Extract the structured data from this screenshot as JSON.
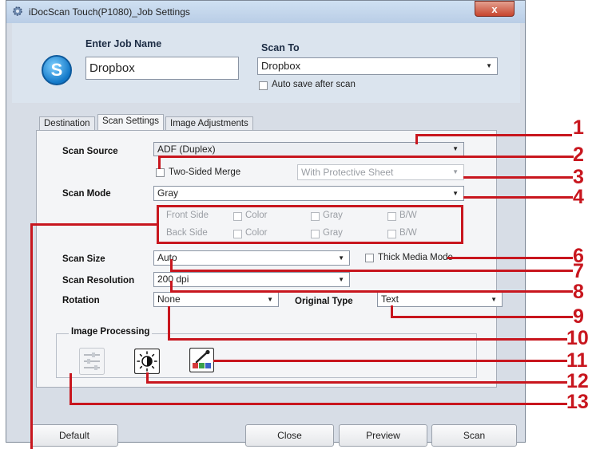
{
  "window": {
    "title": "iDocScan Touch(P1080)_Job Settings",
    "close_glyph": "x"
  },
  "header": {
    "job_name_label": "Enter Job Name",
    "job_name_value": "Dropbox",
    "scan_to_label": "Scan To",
    "scan_to_value": "Dropbox",
    "auto_save_label": "Auto save after scan",
    "logo_letter": "S"
  },
  "tabs": [
    {
      "label": "Destination"
    },
    {
      "label": "Scan Settings"
    },
    {
      "label": "Image Adjustments"
    }
  ],
  "settings": {
    "scan_source_label": "Scan Source",
    "scan_source_value": "ADF (Duplex)",
    "two_sided_merge_label": "Two-Sided Merge",
    "protective_sheet_value": "With Protective Sheet",
    "scan_mode_label": "Scan Mode",
    "scan_mode_value": "Gray",
    "front_side_label": "Front Side",
    "back_side_label": "Back Side",
    "color_label": "Color",
    "gray_label": "Gray",
    "bw_label": "B/W",
    "scan_size_label": "Scan Size",
    "scan_size_value": "Auto",
    "thick_media_label": "Thick Media Mode",
    "scan_resolution_label": "Scan Resolution",
    "scan_resolution_value": "200 dpi",
    "rotation_label": "Rotation",
    "rotation_value": "None",
    "original_type_label": "Original Type",
    "original_type_value": "Text",
    "image_processing_label": "Image Processing"
  },
  "buttons": {
    "default": "Default",
    "close": "Close",
    "preview": "Preview",
    "scan": "Scan"
  },
  "callouts": [
    "1",
    "2",
    "3",
    "4",
    "6",
    "7",
    "8",
    "9",
    "10",
    "11",
    "12",
    "13"
  ],
  "colors": {
    "callout_red": "#c8161e",
    "title_bar": "#b9cde6",
    "panel_bg": "#f4f5f7"
  },
  "icons": [
    "gear-icon",
    "logo-icon",
    "sliders-icon",
    "brightness-icon",
    "color-dropper-icon"
  ]
}
